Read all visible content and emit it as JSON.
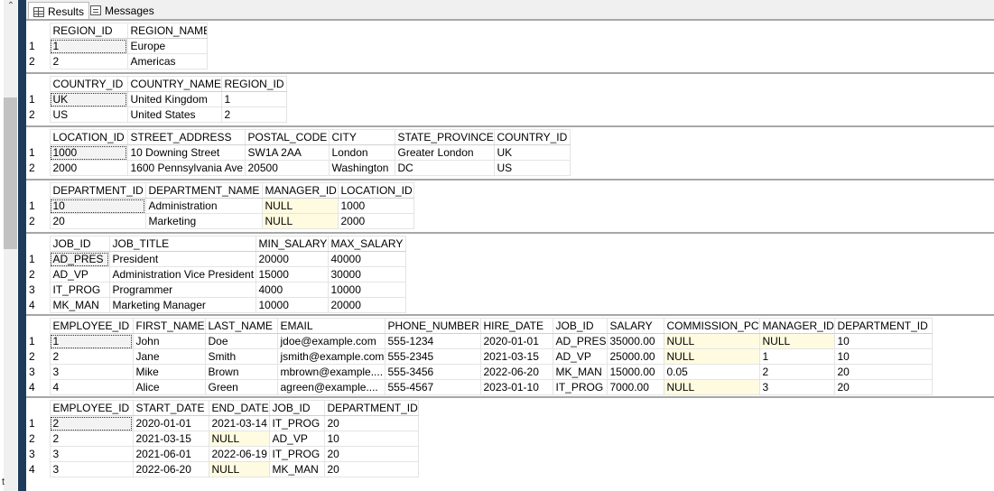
{
  "tabs": [
    {
      "label": "Results",
      "icon": "grid-icon",
      "active": true
    },
    {
      "label": "Messages",
      "icon": "messages-icon",
      "active": false
    }
  ],
  "gutter_char": "t",
  "result_sets": [
    {
      "name": "regions",
      "columns": [
        "REGION_ID",
        "REGION_NAME"
      ],
      "rows": [
        [
          "1",
          "Europe"
        ],
        [
          "2",
          "Americas"
        ]
      ]
    },
    {
      "name": "countries",
      "columns": [
        "COUNTRY_ID",
        "COUNTRY_NAME",
        "REGION_ID"
      ],
      "rows": [
        [
          "UK",
          "United Kingdom",
          "1"
        ],
        [
          "US",
          "United States",
          "2"
        ]
      ]
    },
    {
      "name": "locations",
      "columns": [
        "LOCATION_ID",
        "STREET_ADDRESS",
        "POSTAL_CODE",
        "CITY",
        "STATE_PROVINCE",
        "COUNTRY_ID"
      ],
      "rows": [
        [
          "1000",
          "10 Downing Street",
          "SW1A 2AA",
          "London",
          "Greater London",
          "UK"
        ],
        [
          "2000",
          "1600 Pennsylvania Ave",
          "20500",
          "Washington",
          "DC",
          "US"
        ]
      ]
    },
    {
      "name": "departments",
      "columns": [
        "DEPARTMENT_ID",
        "DEPARTMENT_NAME",
        "MANAGER_ID",
        "LOCATION_ID"
      ],
      "rows": [
        [
          "10",
          "Administration",
          "NULL",
          "1000"
        ],
        [
          "20",
          "Marketing",
          "NULL",
          "2000"
        ]
      ]
    },
    {
      "name": "jobs",
      "columns": [
        "JOB_ID",
        "JOB_TITLE",
        "MIN_SALARY",
        "MAX_SALARY"
      ],
      "rows": [
        [
          "AD_PRES",
          "President",
          "20000",
          "40000"
        ],
        [
          "AD_VP",
          "Administration Vice President",
          "15000",
          "30000"
        ],
        [
          "IT_PROG",
          "Programmer",
          "4000",
          "10000"
        ],
        [
          "MK_MAN",
          "Marketing Manager",
          "10000",
          "20000"
        ]
      ]
    },
    {
      "name": "employees",
      "columns": [
        "EMPLOYEE_ID",
        "FIRST_NAME",
        "LAST_NAME",
        "EMAIL",
        "PHONE_NUMBER",
        "HIRE_DATE",
        "JOB_ID",
        "SALARY",
        "COMMISSION_PCT",
        "MANAGER_ID",
        "DEPARTMENT_ID"
      ],
      "rows": [
        [
          "1",
          "John",
          "Doe",
          "jdoe@example.com",
          "555-1234",
          "2020-01-01",
          "AD_PRES",
          "35000.00",
          "NULL",
          "NULL",
          "10"
        ],
        [
          "2",
          "Jane",
          "Smith",
          "jsmith@example.com",
          "555-2345",
          "2021-03-15",
          "AD_VP",
          "25000.00",
          "NULL",
          "1",
          "10"
        ],
        [
          "3",
          "Mike",
          "Brown",
          "mbrown@example....",
          "555-3456",
          "2022-06-20",
          "MK_MAN",
          "15000.00",
          "0.05",
          "2",
          "20"
        ],
        [
          "4",
          "Alice",
          "Green",
          "agreen@example....",
          "555-4567",
          "2023-01-10",
          "IT_PROG",
          "7000.00",
          "NULL",
          "3",
          "20"
        ]
      ]
    },
    {
      "name": "job_history",
      "columns": [
        "EMPLOYEE_ID",
        "START_DATE",
        "END_DATE",
        "JOB_ID",
        "DEPARTMENT_ID"
      ],
      "rows": [
        [
          "2",
          "2020-01-01",
          "2021-03-14",
          "IT_PROG",
          "20"
        ],
        [
          "2",
          "2021-03-15",
          "NULL",
          "AD_VP",
          "10"
        ],
        [
          "3",
          "2021-06-01",
          "2022-06-19",
          "IT_PROG",
          "20"
        ],
        [
          "3",
          "2022-06-20",
          "NULL",
          "MK_MAN",
          "20"
        ]
      ]
    }
  ]
}
